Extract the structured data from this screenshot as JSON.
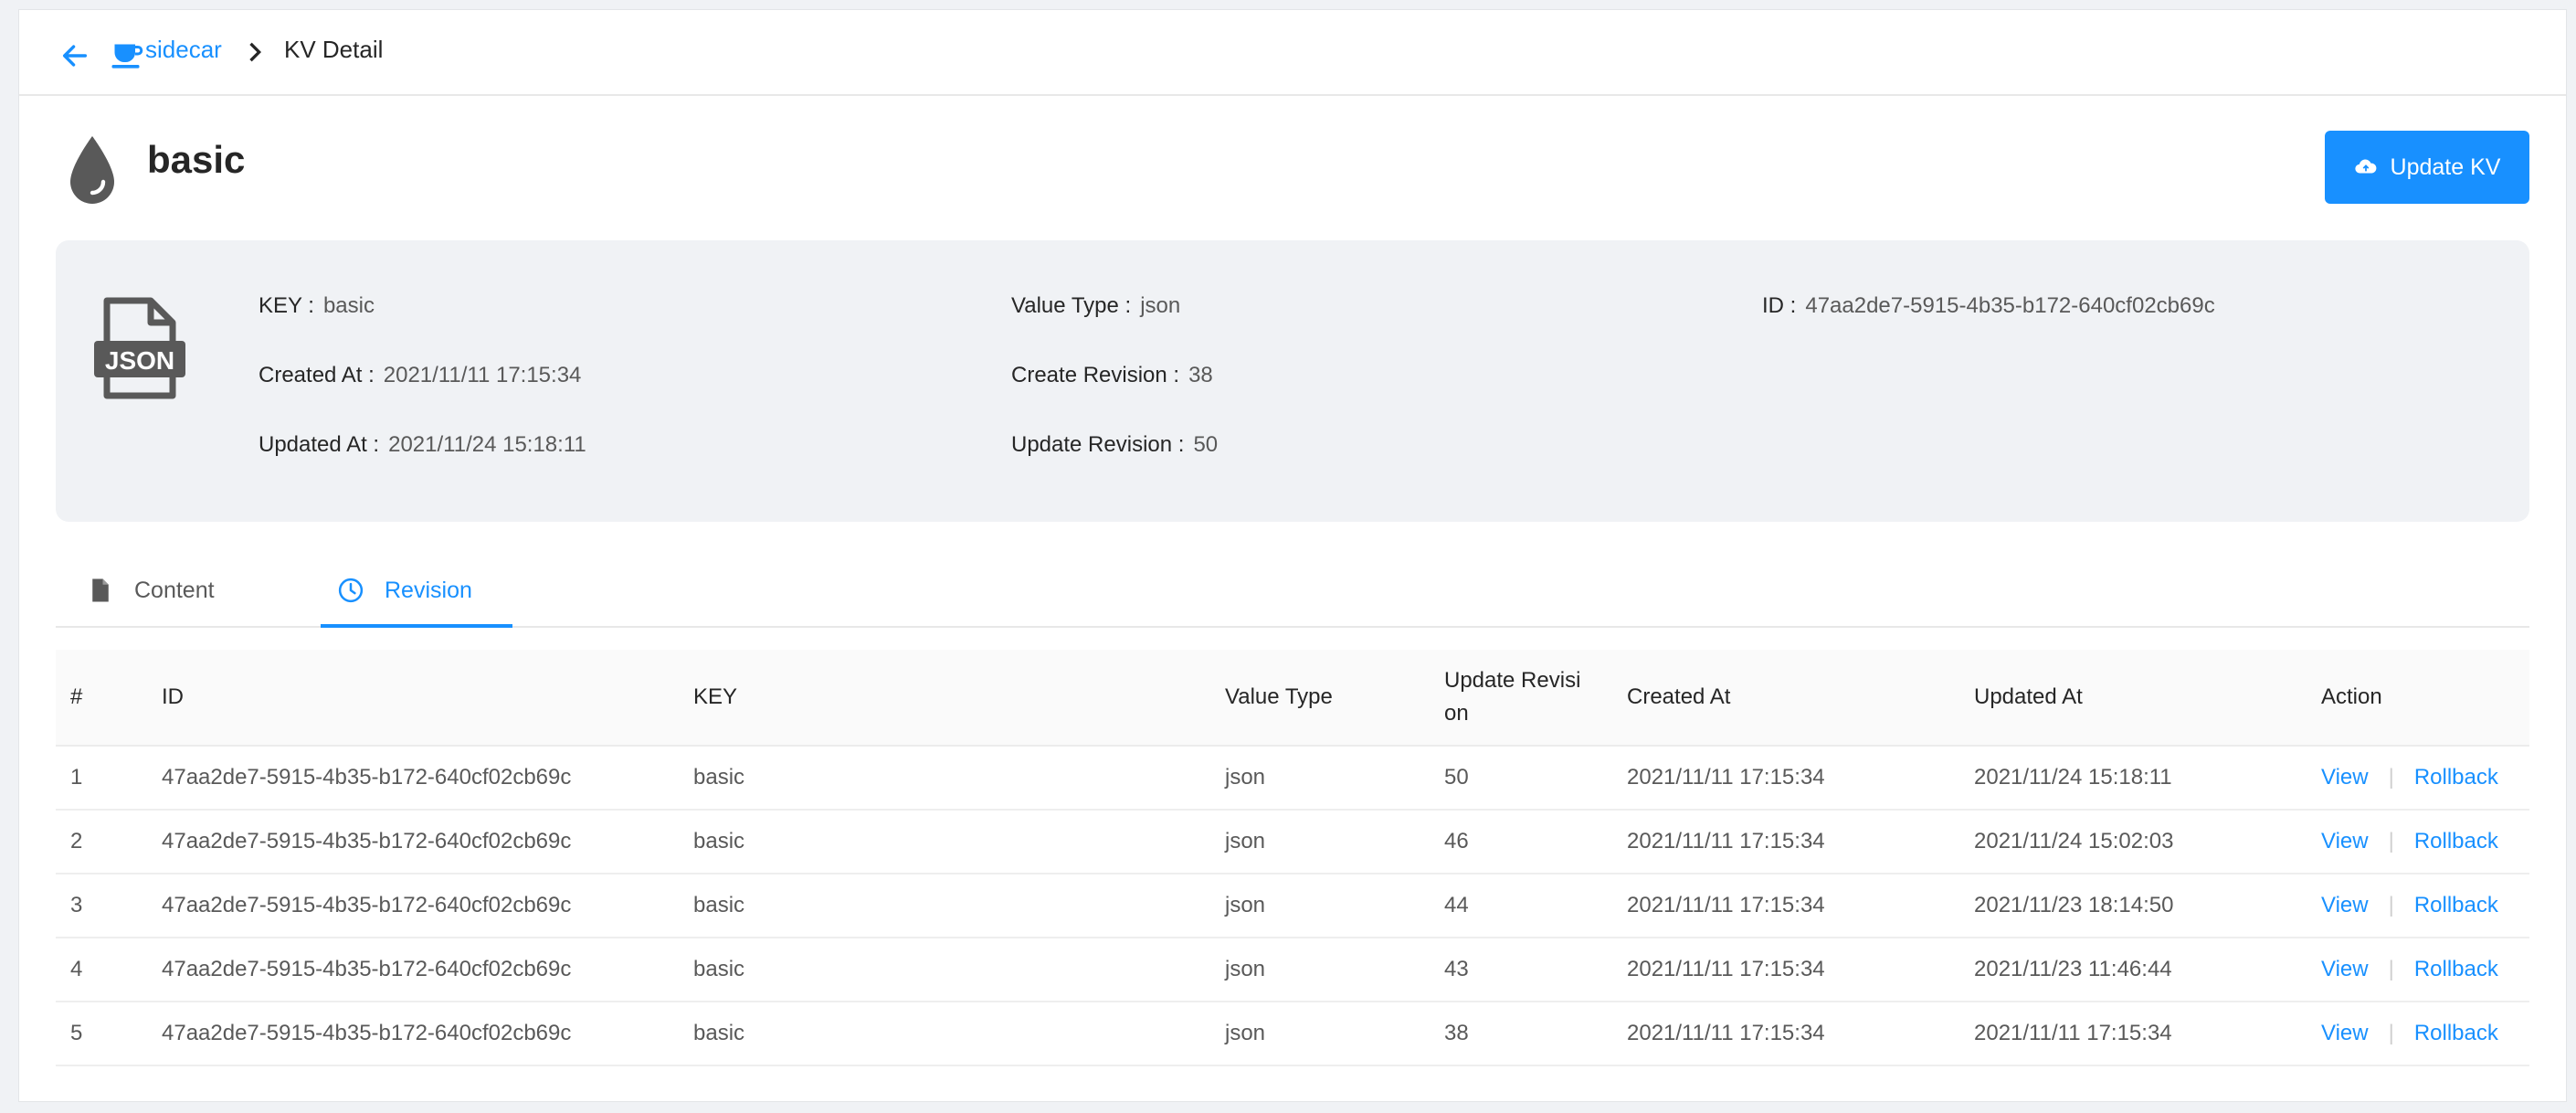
{
  "breadcrumb": {
    "brand": "sidecar",
    "current": "KV Detail"
  },
  "header": {
    "title": "basic",
    "update_button": "Update KV"
  },
  "info": {
    "key_label": "KEY :",
    "key_value": "basic",
    "value_type_label": "Value Type :",
    "value_type_value": "json",
    "id_label": "ID :",
    "id_value": "47aa2de7-5915-4b35-b172-640cf02cb69c",
    "created_at_label": "Created At :",
    "created_at_value": "2021/11/11 17:15:34",
    "create_revision_label": "Create Revision :",
    "create_revision_value": "38",
    "updated_at_label": "Updated At :",
    "updated_at_value": "2021/11/24 15:18:11",
    "update_revision_label": "Update Revision :",
    "update_revision_value": "50"
  },
  "tabs": {
    "content": "Content",
    "revision": "Revision",
    "active": "revision"
  },
  "table": {
    "headers": {
      "num": "#",
      "id": "ID",
      "key": "KEY",
      "value_type": "Value Type",
      "update_revision_1": "Update Revisi",
      "update_revision_2": "on",
      "created_at": "Created At",
      "updated_at": "Updated At",
      "action": "Action"
    },
    "action_view": "View",
    "action_rollback": "Rollback",
    "action_sep": "|",
    "rows": [
      {
        "num": "1",
        "id": "47aa2de7-5915-4b35-b172-640cf02cb69c",
        "key": "basic",
        "value_type": "json",
        "update_revision": "50",
        "created_at": "2021/11/11 17:15:34",
        "updated_at": "2021/11/24 15:18:11"
      },
      {
        "num": "2",
        "id": "47aa2de7-5915-4b35-b172-640cf02cb69c",
        "key": "basic",
        "value_type": "json",
        "update_revision": "46",
        "created_at": "2021/11/11 17:15:34",
        "updated_at": "2021/11/24 15:02:03"
      },
      {
        "num": "3",
        "id": "47aa2de7-5915-4b35-b172-640cf02cb69c",
        "key": "basic",
        "value_type": "json",
        "update_revision": "44",
        "created_at": "2021/11/11 17:15:34",
        "updated_at": "2021/11/23 18:14:50"
      },
      {
        "num": "4",
        "id": "47aa2de7-5915-4b35-b172-640cf02cb69c",
        "key": "basic",
        "value_type": "json",
        "update_revision": "43",
        "created_at": "2021/11/11 17:15:34",
        "updated_at": "2021/11/23 11:46:44"
      },
      {
        "num": "5",
        "id": "47aa2de7-5915-4b35-b172-640cf02cb69c",
        "key": "basic",
        "value_type": "json",
        "update_revision": "38",
        "created_at": "2021/11/11 17:15:34",
        "updated_at": "2021/11/11 17:15:34"
      }
    ]
  },
  "colors": {
    "accent": "#1890ff",
    "panel": "#f0f2f5",
    "text": "#262626",
    "muted": "#595959"
  },
  "icons": {
    "back": "arrow-left-icon",
    "logo": "cup-icon",
    "separator": "chevron-right-icon",
    "kv": "drop-icon",
    "file": "json-file-icon",
    "update": "cloud-upload-icon",
    "content_tab": "file-icon",
    "revision_tab": "clock-icon"
  }
}
